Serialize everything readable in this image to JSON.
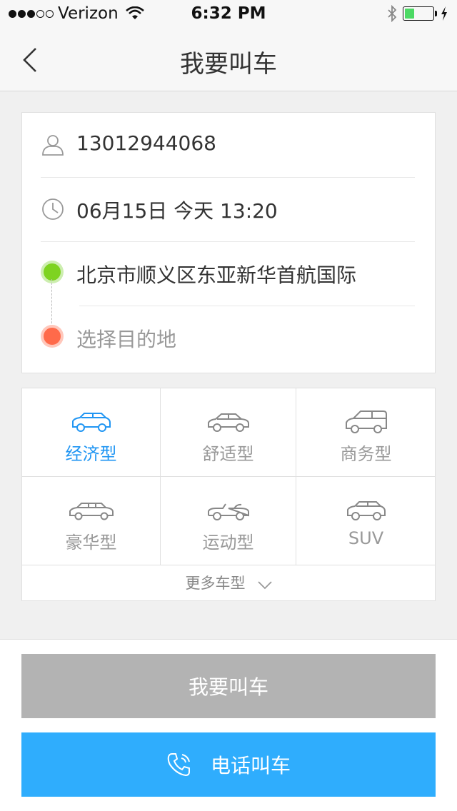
{
  "status_bar": {
    "carrier": "Verizon",
    "time": "6:32 PM",
    "signal_bars_filled": 3,
    "signal_bars_total": 5,
    "battery_level": 0.35,
    "battery_color": "#4cd964"
  },
  "nav": {
    "title": "我要叫车",
    "back_icon": "chevron-left-icon"
  },
  "form": {
    "phone": "13012944068",
    "datetime": "06月15日  今天  13:20",
    "origin": "北京市顺义区东亚新华首航国际",
    "destination_placeholder": "选择目的地",
    "origin_color": "#7ed321",
    "destination_color": "#ff6a4a"
  },
  "car_types": {
    "items": [
      {
        "label": "经济型",
        "icon": "suv-car-icon",
        "selected": true
      },
      {
        "label": "舒适型",
        "icon": "sedan-car-icon",
        "selected": false
      },
      {
        "label": "商务型",
        "icon": "van-car-icon",
        "selected": false
      },
      {
        "label": "豪华型",
        "icon": "limousine-car-icon",
        "selected": false
      },
      {
        "label": "运动型",
        "icon": "convertible-car-icon",
        "selected": false
      },
      {
        "label": "SUV",
        "icon": "suv-car-icon",
        "selected": false
      }
    ],
    "more_label": "更多车型",
    "selected_color": "#2196f3"
  },
  "buttons": {
    "call_label": "我要叫车",
    "phone_call_label": "电话叫车",
    "call_color": "#b3b3b3",
    "phone_call_color": "#2fadfd"
  }
}
